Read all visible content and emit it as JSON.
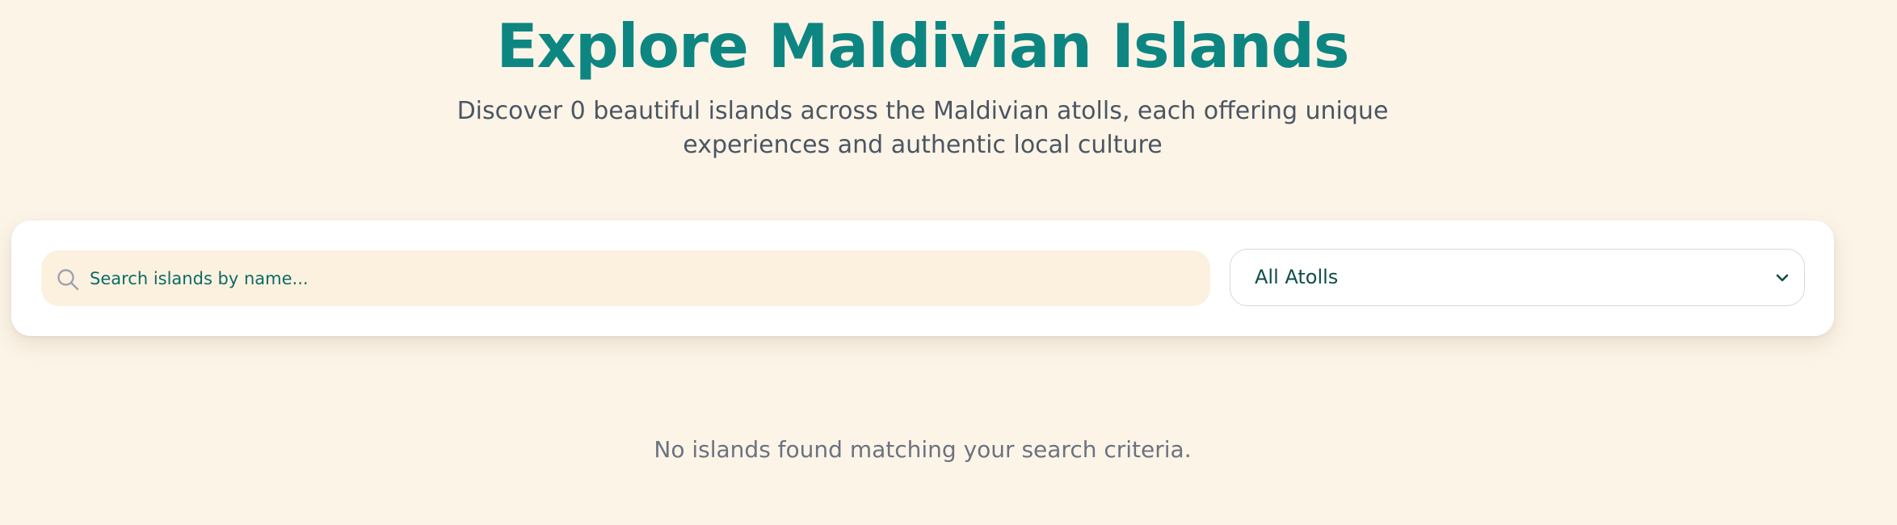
{
  "header": {
    "title": "Explore Maldivian Islands",
    "subtitle": "Discover 0 beautiful islands across the Maldivian atolls, each offering unique experiences and authentic local culture"
  },
  "filters": {
    "search": {
      "icon": "search-icon",
      "value": "",
      "placeholder": "Search islands by name..."
    },
    "atoll_select": {
      "selected": "All Atolls",
      "icon": "chevron-down-icon"
    }
  },
  "results": {
    "empty_message": "No islands found matching your search criteria."
  },
  "colors": {
    "background": "#fcf4e7",
    "accent": "#0d8682",
    "search_background": "#fcf1df",
    "card": "#ffffff"
  }
}
